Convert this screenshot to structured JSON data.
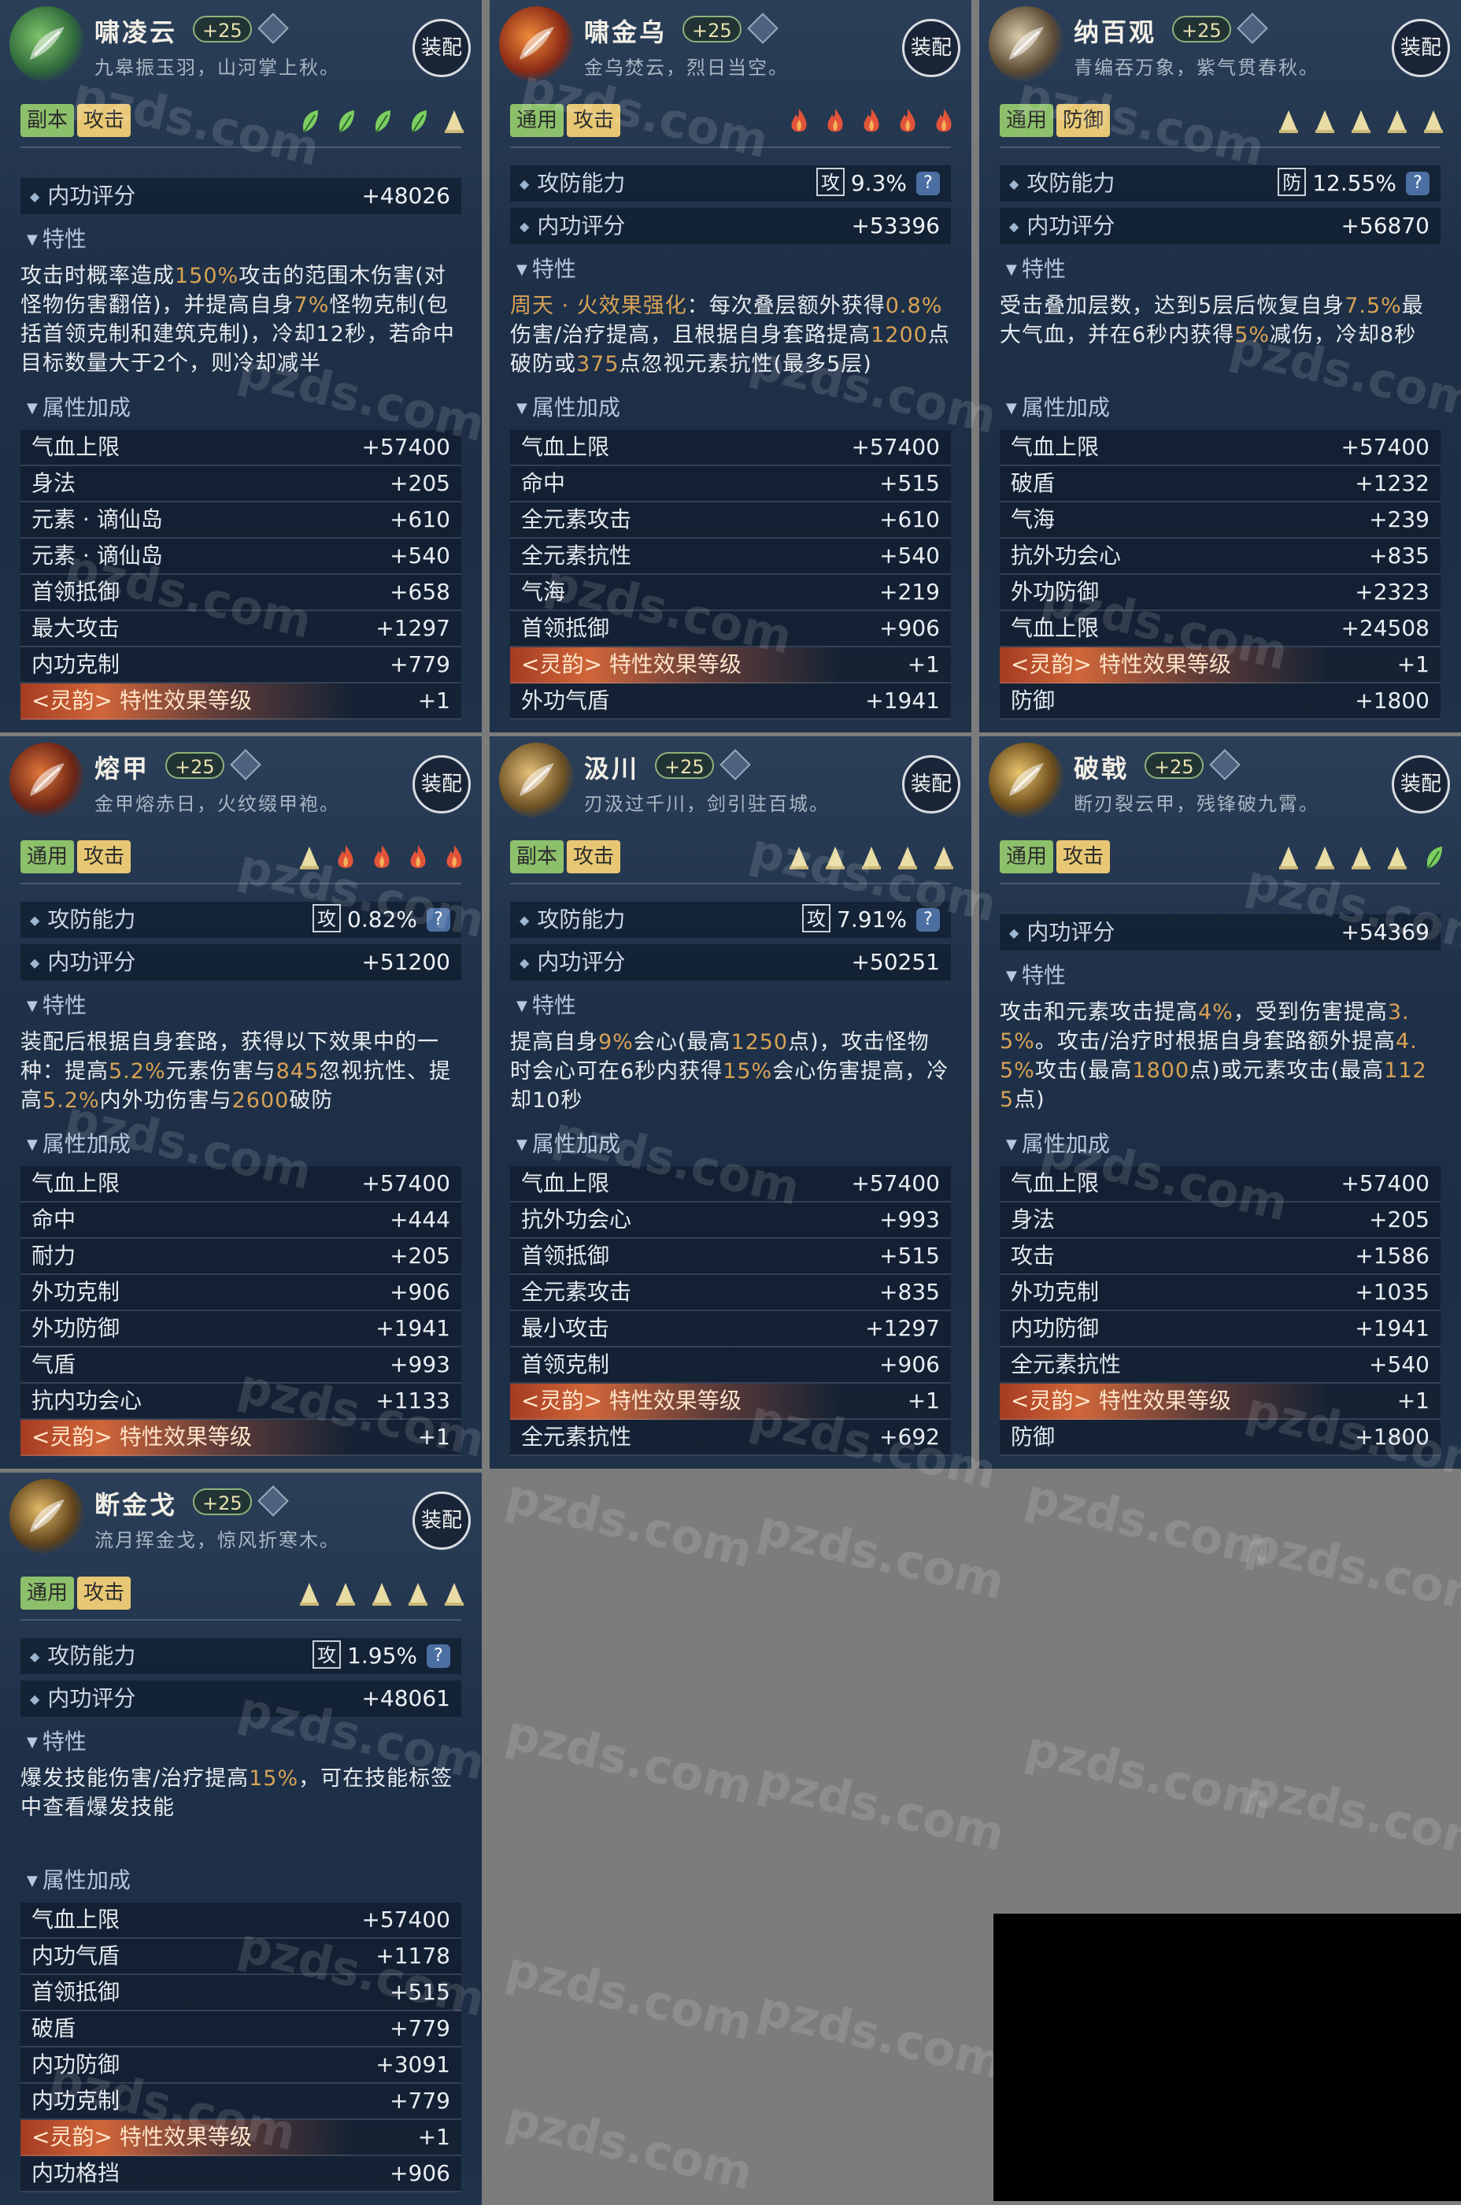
{
  "colors": {
    "page_bg": "#7c7c7c",
    "card_bg": "#1f3149",
    "highlight": "#d8a255",
    "tag_general": "#8dc06b",
    "tag_attack": "#e7c774",
    "special_row": "#c55a33"
  },
  "watermark_text": "pzds.com",
  "cards": [
    {
      "name": "啸凌云",
      "level": "+25",
      "subtitle": "九皋振玉羽，山河掌上秋。",
      "equip_label": "装配",
      "emblem": "green-feather-icon",
      "emblem_colors": [
        "#7fc46a",
        "#2f6a3b"
      ],
      "tags": [
        "副本",
        "攻击"
      ],
      "glyphs": [
        "leaf-icon",
        "leaf-icon",
        "leaf-icon",
        "leaf-icon",
        "bell-icon"
      ],
      "stats": [
        {
          "label": "内功评分",
          "value": "+48026"
        }
      ],
      "trait_label": "特性",
      "trait": [
        {
          "t": "攻击时概率造成"
        },
        {
          "t": "150%",
          "h": true
        },
        {
          "t": "攻击的范围木伤害(对怪物伤害翻倍)，并提高自身"
        },
        {
          "t": "7%",
          "h": true
        },
        {
          "t": "怪物克制(包括首领克制和建筑克制)，冷却12秒，若命中目标数量大于2个，则冷却减半"
        }
      ],
      "attr_label": "属性加成",
      "attrs": [
        {
          "name": "气血上限",
          "value": "+57400"
        },
        {
          "name": "身法",
          "value": "+205"
        },
        {
          "name": "元素 · 谪仙岛",
          "value": "+610"
        },
        {
          "name": "元素 · 谪仙岛",
          "value": "+540"
        },
        {
          "name": "首领抵御",
          "value": "+658"
        },
        {
          "name": "最大攻击",
          "value": "+1297"
        },
        {
          "name": "内功克制",
          "value": "+779"
        },
        {
          "name": "<灵韵> 特性效果等级",
          "value": "+1",
          "special": true
        }
      ]
    },
    {
      "name": "啸金乌",
      "level": "+25",
      "subtitle": "金乌焚云，烈日当空。",
      "equip_label": "装配",
      "emblem": "fire-bird-icon",
      "emblem_colors": [
        "#f08a3a",
        "#8a2a15"
      ],
      "tags": [
        "通用",
        "攻击"
      ],
      "glyphs": [
        "flame-icon",
        "flame-icon",
        "flame-icon",
        "flame-icon",
        "flame-icon"
      ],
      "stats": [
        {
          "label": "攻防能力",
          "box": "攻",
          "value": "9.3%",
          "help": "?"
        },
        {
          "label": "内功评分",
          "value": "+53396"
        }
      ],
      "trait_label": "特性",
      "trait": [
        {
          "t": "周天 · 火效果强化",
          "h": true
        },
        {
          "t": "：每次叠层额外获得"
        },
        {
          "t": "0.8%",
          "h": true
        },
        {
          "t": "伤害/治疗提高，且根据自身套路提高"
        },
        {
          "t": "1200",
          "h": true
        },
        {
          "t": "点破防或"
        },
        {
          "t": "375",
          "h": true
        },
        {
          "t": "点忽视元素抗性(最多5层)"
        }
      ],
      "attr_label": "属性加成",
      "attrs": [
        {
          "name": "气血上限",
          "value": "+57400"
        },
        {
          "name": "命中",
          "value": "+515"
        },
        {
          "name": "全元素攻击",
          "value": "+610"
        },
        {
          "name": "全元素抗性",
          "value": "+540"
        },
        {
          "name": "气海",
          "value": "+219"
        },
        {
          "name": "首领抵御",
          "value": "+906"
        },
        {
          "name": "<灵韵> 特性效果等级",
          "value": "+1",
          "special": true
        },
        {
          "name": "外功气盾",
          "value": "+1941"
        }
      ]
    },
    {
      "name": "纳百观",
      "level": "+25",
      "subtitle": "青编吞万象，紫气贯春秋。",
      "equip_label": "装配",
      "emblem": "scroll-shield-icon",
      "emblem_colors": [
        "#d7c9a6",
        "#5b4a34"
      ],
      "tags": [
        "通用",
        "防御"
      ],
      "glyphs": [
        "bell-icon",
        "bell-icon",
        "bell-icon",
        "bell-icon",
        "bell-icon"
      ],
      "stats": [
        {
          "label": "攻防能力",
          "box": "防",
          "value": "12.55%",
          "help": "?"
        },
        {
          "label": "内功评分",
          "value": "+56870"
        }
      ],
      "trait_label": "特性",
      "trait": [
        {
          "t": "受击叠加层数，达到5层后恢复自身"
        },
        {
          "t": "7.5%",
          "h": true
        },
        {
          "t": "最大气血，并在6秒内获得"
        },
        {
          "t": "5%",
          "h": true
        },
        {
          "t": "减伤，冷却8秒"
        }
      ],
      "attr_label": "属性加成",
      "attrs": [
        {
          "name": "气血上限",
          "value": "+57400"
        },
        {
          "name": "破盾",
          "value": "+1232"
        },
        {
          "name": "气海",
          "value": "+239"
        },
        {
          "name": "抗外功会心",
          "value": "+835"
        },
        {
          "name": "外功防御",
          "value": "+2323"
        },
        {
          "name": "气血上限",
          "value": "+24508"
        },
        {
          "name": "<灵韵> 特性效果等级",
          "value": "+1",
          "special": true
        },
        {
          "name": "防御",
          "value": "+1800"
        }
      ]
    },
    {
      "name": "熔甲",
      "level": "+25",
      "subtitle": "金甲熔赤日，火纹缀甲袍。",
      "equip_label": "装配",
      "emblem": "flame-armor-icon",
      "emblem_colors": [
        "#e0743a",
        "#6a2414"
      ],
      "tags": [
        "通用",
        "攻击"
      ],
      "glyphs": [
        "bell-icon",
        "flame-icon",
        "flame-icon",
        "flame-icon",
        "flame-icon"
      ],
      "stats": [
        {
          "label": "攻防能力",
          "box": "攻",
          "value": "0.82%",
          "help": "?"
        },
        {
          "label": "内功评分",
          "value": "+51200"
        }
      ],
      "trait_label": "特性",
      "trait": [
        {
          "t": "装配后根据自身套路，获得以下效果中的一种：提高"
        },
        {
          "t": "5.2%",
          "h": true
        },
        {
          "t": "元素伤害与"
        },
        {
          "t": "845",
          "h": true
        },
        {
          "t": "忽视抗性、提高"
        },
        {
          "t": "5.2%",
          "h": true
        },
        {
          "t": "内外功伤害与"
        },
        {
          "t": "2600",
          "h": true
        },
        {
          "t": "破防"
        }
      ],
      "attr_label": "属性加成",
      "attrs": [
        {
          "name": "气血上限",
          "value": "+57400"
        },
        {
          "name": "命中",
          "value": "+444"
        },
        {
          "name": "耐力",
          "value": "+205"
        },
        {
          "name": "外功克制",
          "value": "+906"
        },
        {
          "name": "外功防御",
          "value": "+1941"
        },
        {
          "name": "气盾",
          "value": "+993"
        },
        {
          "name": "抗内功会心",
          "value": "+1133"
        },
        {
          "name": "<灵韵> 特性效果等级",
          "value": "+1",
          "special": true
        }
      ]
    },
    {
      "name": "汲川",
      "level": "+25",
      "subtitle": "刃汲过千川，剑引驻百城。",
      "equip_label": "装配",
      "emblem": "golden-wave-icon",
      "emblem_colors": [
        "#e5c07a",
        "#6b4f22"
      ],
      "tags": [
        "副本",
        "攻击"
      ],
      "glyphs": [
        "bell-icon",
        "bell-icon",
        "bell-icon",
        "bell-icon",
        "bell-icon"
      ],
      "stats": [
        {
          "label": "攻防能力",
          "box": "攻",
          "value": "7.91%",
          "help": "?"
        },
        {
          "label": "内功评分",
          "value": "+50251"
        }
      ],
      "trait_label": "特性",
      "trait": [
        {
          "t": "提高自身"
        },
        {
          "t": "9%",
          "h": true
        },
        {
          "t": "会心(最高"
        },
        {
          "t": "1250",
          "h": true
        },
        {
          "t": "点)，攻击怪物时会心可在6秒内获得"
        },
        {
          "t": "15%",
          "h": true
        },
        {
          "t": "会心伤害提高，冷却10秒"
        }
      ],
      "attr_label": "属性加成",
      "attrs": [
        {
          "name": "气血上限",
          "value": "+57400"
        },
        {
          "name": "抗外功会心",
          "value": "+993"
        },
        {
          "name": "首领抵御",
          "value": "+515"
        },
        {
          "name": "全元素攻击",
          "value": "+835"
        },
        {
          "name": "最小攻击",
          "value": "+1297"
        },
        {
          "name": "首领克制",
          "value": "+906"
        },
        {
          "name": "<灵韵> 特性效果等级",
          "value": "+1",
          "special": true
        },
        {
          "name": "全元素抗性",
          "value": "+692"
        }
      ]
    },
    {
      "name": "破戟",
      "level": "+25",
      "subtitle": "断刃裂云甲，残锋破九霄。",
      "equip_label": "装配",
      "emblem": "broken-halberd-icon",
      "emblem_colors": [
        "#e8c46c",
        "#6a4a1a"
      ],
      "tags": [
        "通用",
        "攻击"
      ],
      "glyphs": [
        "bell-icon",
        "bell-icon",
        "bell-icon",
        "bell-icon",
        "leaf-icon"
      ],
      "stats": [
        {
          "label": "内功评分",
          "value": "+54369"
        }
      ],
      "trait_label": "特性",
      "trait": [
        {
          "t": "攻击和元素攻击提高"
        },
        {
          "t": "4%",
          "h": true
        },
        {
          "t": "，受到伤害提高"
        },
        {
          "t": "3.5%",
          "h": true
        },
        {
          "t": "。攻击/治疗时根据自身套路额外提高"
        },
        {
          "t": "4.5%",
          "h": true
        },
        {
          "t": "攻击(最高"
        },
        {
          "t": "1800",
          "h": true
        },
        {
          "t": "点)或元素攻击(最高"
        },
        {
          "t": "1125",
          "h": true
        },
        {
          "t": "点)"
        }
      ],
      "attr_label": "属性加成",
      "attrs": [
        {
          "name": "气血上限",
          "value": "+57400"
        },
        {
          "name": "身法",
          "value": "+205"
        },
        {
          "name": "攻击",
          "value": "+1586"
        },
        {
          "name": "外功克制",
          "value": "+1035"
        },
        {
          "name": "内功防御",
          "value": "+1941"
        },
        {
          "name": "全元素抗性",
          "value": "+540"
        },
        {
          "name": "<灵韵> 特性效果等级",
          "value": "+1",
          "special": true
        },
        {
          "name": "防御",
          "value": "+1800"
        }
      ]
    },
    {
      "name": "断金戈",
      "level": "+25",
      "subtitle": "流月挥金戈，惊风折寒木。",
      "equip_label": "装配",
      "emblem": "golden-spear-icon",
      "emblem_colors": [
        "#e2b968",
        "#5e421a"
      ],
      "tags": [
        "通用",
        "攻击"
      ],
      "glyphs": [
        "bell-icon",
        "bell-icon",
        "bell-icon",
        "bell-icon",
        "bell-icon"
      ],
      "stats": [
        {
          "label": "攻防能力",
          "box": "攻",
          "value": "1.95%",
          "help": "?"
        },
        {
          "label": "内功评分",
          "value": "+48061"
        }
      ],
      "trait_label": "特性",
      "trait": [
        {
          "t": "爆发技能伤害/治疗提高"
        },
        {
          "t": "15%",
          "h": true
        },
        {
          "t": "，可在技能标签中查看爆发技能"
        }
      ],
      "attr_label": "属性加成",
      "attrs": [
        {
          "name": "气血上限",
          "value": "+57400"
        },
        {
          "name": "内功气盾",
          "value": "+1178"
        },
        {
          "name": "首领抵御",
          "value": "+515"
        },
        {
          "name": "破盾",
          "value": "+779"
        },
        {
          "name": "内功防御",
          "value": "+3091"
        },
        {
          "name": "内功克制",
          "value": "+779"
        },
        {
          "name": "<灵韵> 特性效果等级",
          "value": "+1",
          "special": true
        },
        {
          "name": "内功格挡",
          "value": "+906"
        }
      ]
    }
  ]
}
